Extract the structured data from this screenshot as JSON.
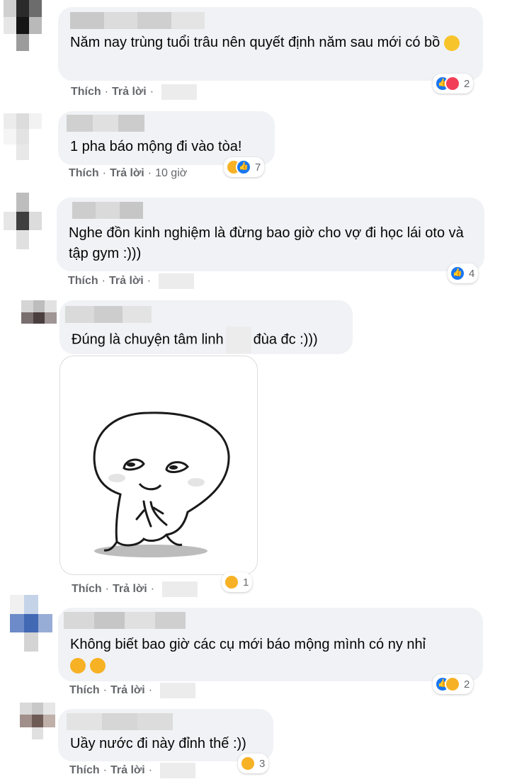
{
  "comments": [
    {
      "text": "Năm nay trùng tuổi trâu nên quyết định năm sau mới có bồ",
      "emoji": "smile-emoji",
      "reactions": [
        "like",
        "love"
      ],
      "reaction_count": "2",
      "like_label": "Thích",
      "reply_label": "Trả lời",
      "timestamp": ""
    },
    {
      "text": "1 pha báo mộng đi vào tòa!",
      "reactions": [
        "haha",
        "like"
      ],
      "reaction_count": "7",
      "like_label": "Thích",
      "reply_label": "Trả lời",
      "timestamp": "10 giờ"
    },
    {
      "text": "Nghe đồn kinh nghiệm là đừng bao giờ cho vợ đi học lái oto và tập gym :)))",
      "reactions": [
        "like"
      ],
      "reaction_count": "4",
      "like_label": "Thích",
      "reply_label": "Trả lời",
      "timestamp": ""
    },
    {
      "text_before": "Đúng là chuyện tâm linh",
      "text_after": "đùa đc :)))",
      "reactions": [
        "haha"
      ],
      "reaction_count": "1",
      "like_label": "Thích",
      "reply_label": "Trả lời",
      "timestamp": "",
      "sticker": "sticker-image"
    },
    {
      "text": "Không biết bao giờ các cụ mới báo mộng mình có ny nhỉ",
      "emoji": "pleading-emoji",
      "reactions": [
        "like",
        "sad"
      ],
      "reaction_count": "2",
      "like_label": "Thích",
      "reply_label": "Trả lời",
      "timestamp": ""
    },
    {
      "text": "Uầy nước đi này đỉnh thế :))",
      "reactions": [
        "haha"
      ],
      "reaction_count": "3",
      "like_label": "Thích",
      "reply_label": "Trả lời",
      "timestamp": ""
    }
  ],
  "colors": {
    "bubble": "#f0f2f5",
    "like": "#1877f2",
    "love": "#f33e58",
    "haha": "#f7b125",
    "meta_text": "#65676b"
  }
}
